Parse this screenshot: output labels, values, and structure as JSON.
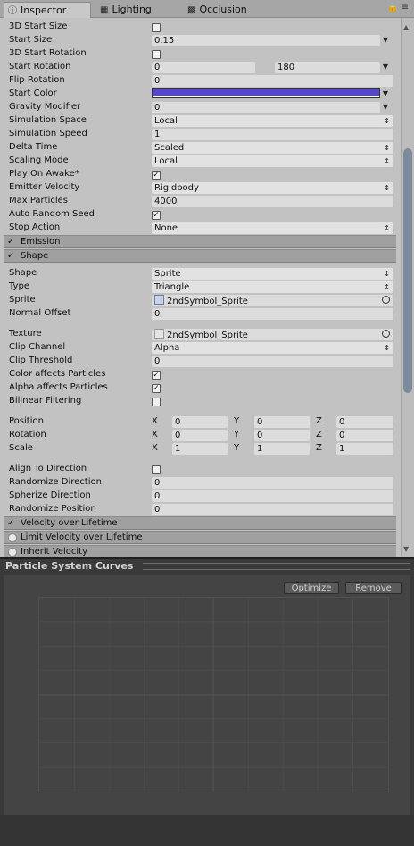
{
  "tabs": [
    {
      "label": "Inspector",
      "icon": "info-icon",
      "active": true
    },
    {
      "label": "Lighting",
      "icon": "lighting-icon",
      "active": false
    },
    {
      "label": "Occlusion",
      "icon": "occlusion-icon",
      "active": false
    }
  ],
  "main": {
    "start_3d_size": {
      "label": "3D Start Size",
      "checked": false
    },
    "start_size": {
      "label": "Start Size",
      "value": "0.15"
    },
    "start_3d_rotation": {
      "label": "3D Start Rotation",
      "checked": false
    },
    "start_rotation": {
      "label": "Start Rotation",
      "value_min": "0",
      "value_max": "180"
    },
    "flip_rotation": {
      "label": "Flip Rotation",
      "value": "0"
    },
    "start_color": {
      "label": "Start Color",
      "color": "#5548cc"
    },
    "gravity_modifier": {
      "label": "Gravity Modifier",
      "value": "0"
    },
    "simulation_space": {
      "label": "Simulation Space",
      "value": "Local"
    },
    "simulation_speed": {
      "label": "Simulation Speed",
      "value": "1"
    },
    "delta_time": {
      "label": "Delta Time",
      "value": "Scaled"
    },
    "scaling_mode": {
      "label": "Scaling Mode",
      "value": "Local"
    },
    "play_on_awake": {
      "label": "Play On Awake*",
      "checked": true
    },
    "emitter_velocity": {
      "label": "Emitter Velocity",
      "value": "Rigidbody"
    },
    "max_particles": {
      "label": "Max Particles",
      "value": "4000"
    },
    "auto_random_seed": {
      "label": "Auto Random Seed",
      "checked": true
    },
    "stop_action": {
      "label": "Stop Action",
      "value": "None"
    }
  },
  "sections": {
    "emission": "Emission",
    "shape": "Shape",
    "velocity": "Velocity over Lifetime",
    "limit_velocity": "Limit Velocity over Lifetime",
    "inherit_velocity": "Inherit Velocity"
  },
  "shape": {
    "shape": {
      "label": "Shape",
      "value": "Sprite"
    },
    "type": {
      "label": "Type",
      "value": "Triangle"
    },
    "sprite": {
      "label": "Sprite",
      "value": "2ndSymbol_Sprite"
    },
    "normal_offset": {
      "label": "Normal Offset",
      "value": "0"
    },
    "texture": {
      "label": "Texture",
      "value": "2ndSymbol_Sprite"
    },
    "clip_channel": {
      "label": "Clip Channel",
      "value": "Alpha"
    },
    "clip_threshold": {
      "label": "Clip Threshold",
      "value": "0"
    },
    "color_affects": {
      "label": "Color affects Particles",
      "checked": true
    },
    "alpha_affects": {
      "label": "Alpha affects Particles",
      "checked": true
    },
    "bilinear": {
      "label": "Bilinear Filtering",
      "checked": false
    },
    "position": {
      "label": "Position",
      "x": "0",
      "y": "0",
      "z": "0"
    },
    "rotation": {
      "label": "Rotation",
      "x": "0",
      "y": "0",
      "z": "0"
    },
    "scale": {
      "label": "Scale",
      "x": "1",
      "y": "1",
      "z": "1"
    },
    "align": {
      "label": "Align To Direction",
      "checked": false
    },
    "randomize_direction": {
      "label": "Randomize Direction",
      "value": "0"
    },
    "spherize_direction": {
      "label": "Spherize Direction",
      "value": "0"
    },
    "randomize_position": {
      "label": "Randomize Position",
      "value": "0"
    }
  },
  "axes": {
    "x": "X",
    "y": "Y",
    "z": "Z"
  },
  "curves": {
    "title": "Particle System Curves",
    "optimize": "Optimize",
    "remove": "Remove"
  }
}
